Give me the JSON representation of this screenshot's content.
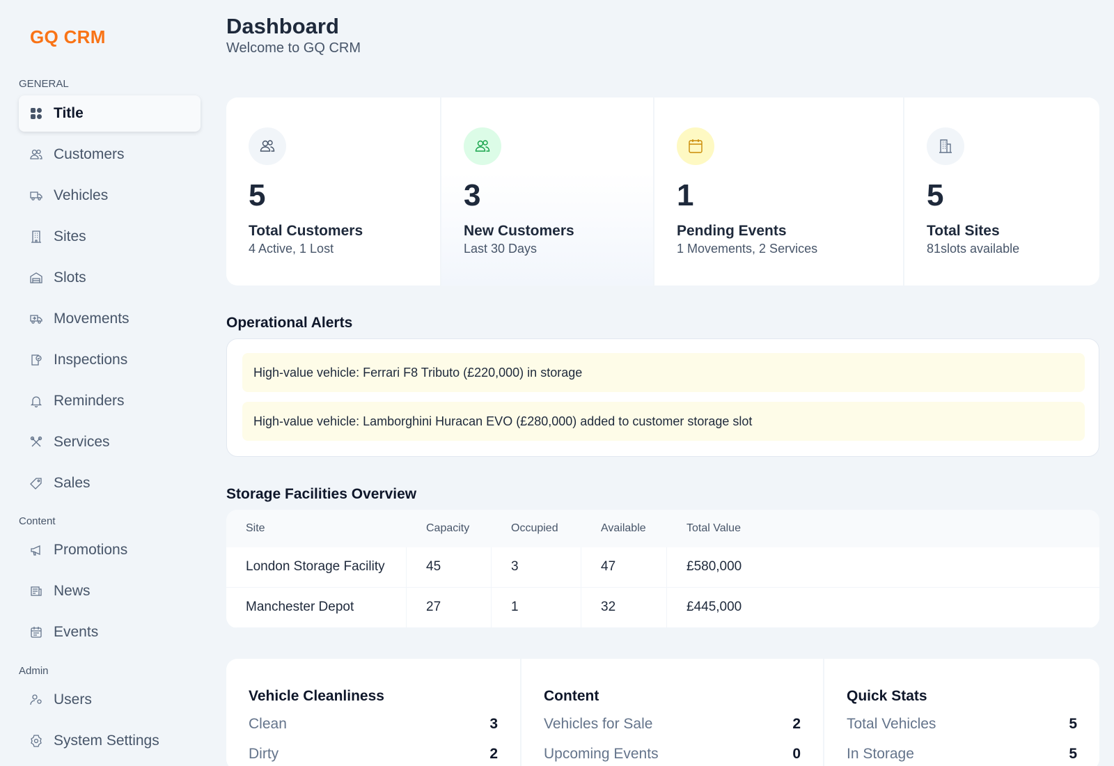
{
  "app": {
    "brand": "GQ CRM"
  },
  "sidebar": {
    "sections": {
      "general": "GENERAL",
      "content": "Content",
      "admin": "Admin"
    },
    "general_items": [
      {
        "label": "Title",
        "icon": "grid-icon",
        "active": true
      },
      {
        "label": "Customers",
        "icon": "users-icon"
      },
      {
        "label": "Vehicles",
        "icon": "truck-icon"
      },
      {
        "label": "Sites",
        "icon": "building-icon"
      },
      {
        "label": "Slots",
        "icon": "garage-icon"
      },
      {
        "label": "Movements",
        "icon": "transfer-truck-icon"
      },
      {
        "label": "Inspections",
        "icon": "clipboard-check-icon"
      },
      {
        "label": "Reminders",
        "icon": "bell-icon"
      },
      {
        "label": "Services",
        "icon": "tools-icon"
      },
      {
        "label": "Sales",
        "icon": "tag-icon"
      }
    ],
    "content_items": [
      {
        "label": "Promotions",
        "icon": "megaphone-icon"
      },
      {
        "label": "News",
        "icon": "newspaper-icon"
      },
      {
        "label": "Events",
        "icon": "calendar-icon"
      }
    ],
    "admin_items": [
      {
        "label": "Users",
        "icon": "user-cog-icon"
      },
      {
        "label": "System Settings",
        "icon": "settings-icon"
      }
    ]
  },
  "header": {
    "title": "Dashboard",
    "subtitle": "Welcome to GQ CRM"
  },
  "stats": [
    {
      "value": "5",
      "label": "Total Customers",
      "sub": "4 Active, 1 Lost",
      "icon": "users-icon",
      "icon_bg": "#f1f5f9",
      "icon_color": "#475569"
    },
    {
      "value": "3",
      "label": "New Customers",
      "sub": "Last 30 Days",
      "icon": "users-icon",
      "icon_bg": "#dcfce7",
      "icon_color": "#16a34a"
    },
    {
      "value": "1",
      "label": "Pending Events",
      "sub": "1 Movements, 2 Services",
      "icon": "calendar-icon",
      "icon_bg": "#fef9c3",
      "icon_color": "#ca8a04"
    },
    {
      "value": "5",
      "label": "Total Sites",
      "sub": "81slots available",
      "icon": "building-icon",
      "icon_bg": "#f1f5f9",
      "icon_color": "#64748b"
    }
  ],
  "alerts": {
    "title": "Operational Alerts",
    "items": [
      "High-value vehicle: Ferrari F8 Tributo (£220,000) in storage",
      "High-value vehicle: Lamborghini Huracan EVO (£280,000) added to customer storage slot"
    ]
  },
  "facilities": {
    "title": "Storage Facilities Overview",
    "columns": [
      "Site",
      "Capacity",
      "Occupied",
      "Available",
      "Total Value"
    ],
    "rows": [
      [
        "London Storage Facility",
        "45",
        "3",
        "47",
        "£580,000"
      ],
      [
        "Manchester Depot",
        "27",
        "1",
        "32",
        "£445,000"
      ]
    ]
  },
  "summary": [
    {
      "title": "Vehicle Cleanliness",
      "rows": [
        {
          "label": "Clean",
          "value": "3"
        },
        {
          "label": "Dirty",
          "value": "2"
        }
      ]
    },
    {
      "title": "Content",
      "rows": [
        {
          "label": "Vehicles for Sale",
          "value": "2"
        },
        {
          "label": "Upcoming Events",
          "value": "0"
        }
      ]
    },
    {
      "title": "Quick Stats",
      "rows": [
        {
          "label": "Total Vehicles",
          "value": "5"
        },
        {
          "label": "In Storage",
          "value": "5"
        }
      ]
    }
  ]
}
